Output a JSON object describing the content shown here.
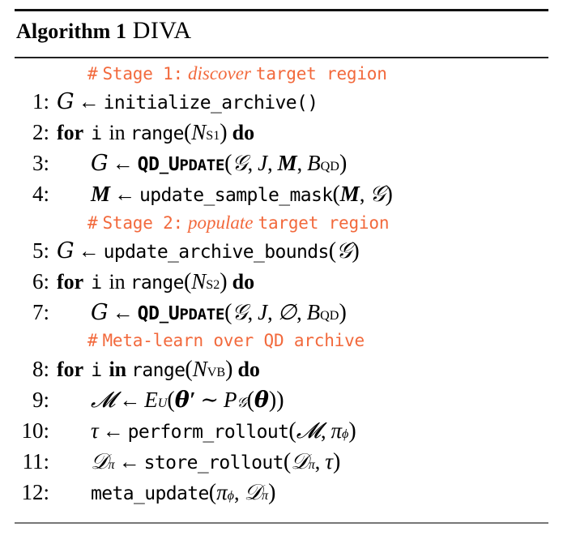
{
  "header": {
    "keyword": "Algorithm 1",
    "name": "DIVA"
  },
  "comments": {
    "stage1": {
      "hash": "#",
      "prefix": "Stage 1:",
      "emphasis": "discover",
      "suffix": "target region"
    },
    "stage2": {
      "hash": "#",
      "prefix": "Stage 2:",
      "emphasis": "populate",
      "suffix": "target region"
    },
    "meta": {
      "hash": "#",
      "text": "Meta-learn over QD archive"
    }
  },
  "lines": {
    "l1": {
      "no": "1:",
      "target": "G",
      "fn": "initialize_archive()"
    },
    "l2": {
      "no": "2:",
      "for": "for",
      "var": "i",
      "in": "in",
      "range": "range",
      "bound": "N",
      "bound_sub": "S1",
      "do": "do"
    },
    "l3": {
      "no": "3:",
      "target": "G",
      "fn": "QD_UPDATE",
      "fn_display": "QD_UPDATE",
      "args": "G, J, M, B_QD"
    },
    "l4": {
      "no": "4:",
      "target": "M",
      "fn": "update_sample_mask",
      "args": "M, G"
    },
    "l5": {
      "no": "5:",
      "target": "G",
      "fn": "update_archive_bounds",
      "args": "G"
    },
    "l6": {
      "no": "6:",
      "for": "for",
      "var": "i",
      "in": "in",
      "range": "range",
      "bound": "N",
      "bound_sub": "S2",
      "do": "do"
    },
    "l7": {
      "no": "7:",
      "target": "G",
      "fn": "QD_UPDATE",
      "args": "G, J, ∅, B_QD"
    },
    "l8": {
      "no": "8:",
      "for": "for",
      "var": "i",
      "in": "in",
      "range": "range",
      "bound": "N",
      "bound_sub": "VB",
      "do": "do"
    },
    "l9": {
      "no": "9:",
      "target": "M",
      "expr": "E_U(θ' ~ P_G(θ))"
    },
    "l10": {
      "no": "10:",
      "target": "τ",
      "fn": "perform_rollout",
      "args": "M, π_φ"
    },
    "l11": {
      "no": "11:",
      "target": "D_π",
      "fn": "store_rollout",
      "args": "D_π, τ"
    },
    "l12": {
      "no": "12:",
      "fn": "meta_update",
      "args": "π_φ, D_π"
    }
  },
  "symbols": {
    "arrow": "←",
    "tilde": "∼",
    "emptyset": "∅",
    "archive": "ᵊ2",
    "model": "ᵊC",
    "dataset": "ᵉF",
    "tau": "τ",
    "pi": "π",
    "phi": "φ",
    "theta": "θ",
    "prime": "′"
  },
  "colors": {
    "comment": "#F2693C",
    "text": "#000000",
    "rule_top": "#111111",
    "rule_bottom": "#777777"
  }
}
